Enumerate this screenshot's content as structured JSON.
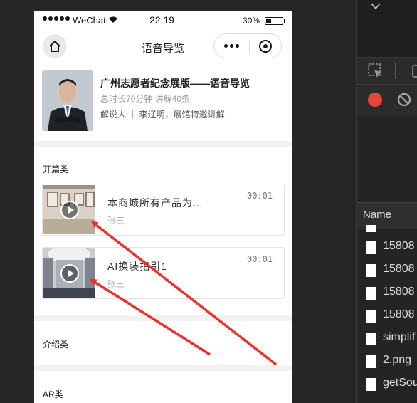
{
  "status_bar": {
    "carrier": "WeChat",
    "time": "22:19",
    "battery": "30%"
  },
  "navbar": {
    "title": "语音导览"
  },
  "guide": {
    "title": "广州志愿者纪念展版——语音导览",
    "meta": "总时长70分钟  讲解40条",
    "narrator": "解说人 ｜ 李辽明，展馆特邀讲解"
  },
  "sections": [
    {
      "title": "开篇类"
    },
    {
      "title": "介绍类"
    },
    {
      "title": "AR类"
    }
  ],
  "tracks": [
    {
      "title": "本商城所有产品为…",
      "author": "张三",
      "duration": "00:01"
    },
    {
      "title": "AI换装指引1",
      "author": "张三",
      "duration": "00:01"
    }
  ],
  "devtools": {
    "column_header": "Name",
    "files": [
      "15808",
      "15808",
      "15808",
      "15808",
      "simplif",
      "2.png",
      "getSou"
    ]
  },
  "colors": {
    "arrow": "#e8322a",
    "record": "#e8433a"
  }
}
